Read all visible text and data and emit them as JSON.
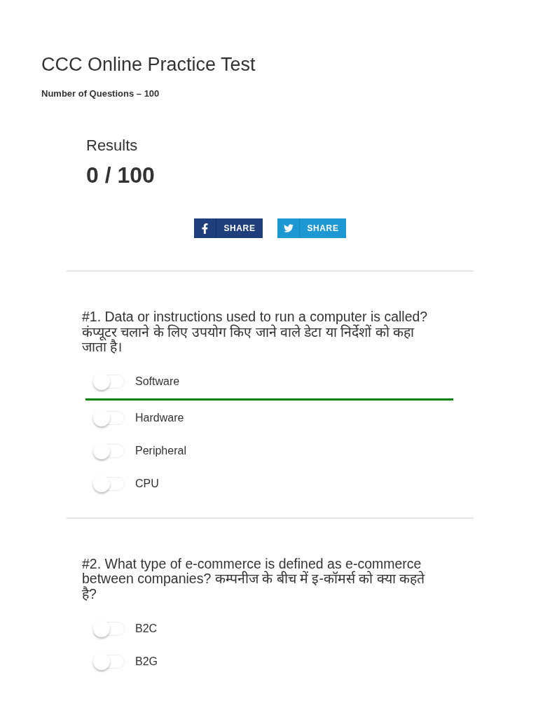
{
  "page": {
    "title": "CCC Online Practice Test",
    "subtitle": "Number of Questions – 100"
  },
  "results": {
    "heading": "Results",
    "score": "0 / 100"
  },
  "share_buttons": [
    {
      "kind": "facebook",
      "label": "SHARE"
    },
    {
      "kind": "twitter",
      "label": "SHARE"
    }
  ],
  "questions": [
    {
      "text": "#1. Data or instructions used to run a computer is called? कंप्यूटर चलाने के लिए उपयोग किए जाने वाले डेटा या निर्देशों को कहा जाता है।",
      "options": [
        {
          "label": "Software",
          "on": false,
          "correct": true
        },
        {
          "label": "Hardware",
          "on": false,
          "correct": false
        },
        {
          "label": "Peripheral",
          "on": false,
          "correct": false
        },
        {
          "label": "CPU",
          "on": false,
          "correct": false
        }
      ]
    },
    {
      "text": "#2. What type of e-commerce is defined as e-commerce between companies? कम्पनीज के बीच में इ-कॉमर्स को क्या कहते है?",
      "options": [
        {
          "label": "B2C",
          "on": false,
          "correct": false
        },
        {
          "label": "B2G",
          "on": false,
          "correct": false
        }
      ]
    }
  ]
}
